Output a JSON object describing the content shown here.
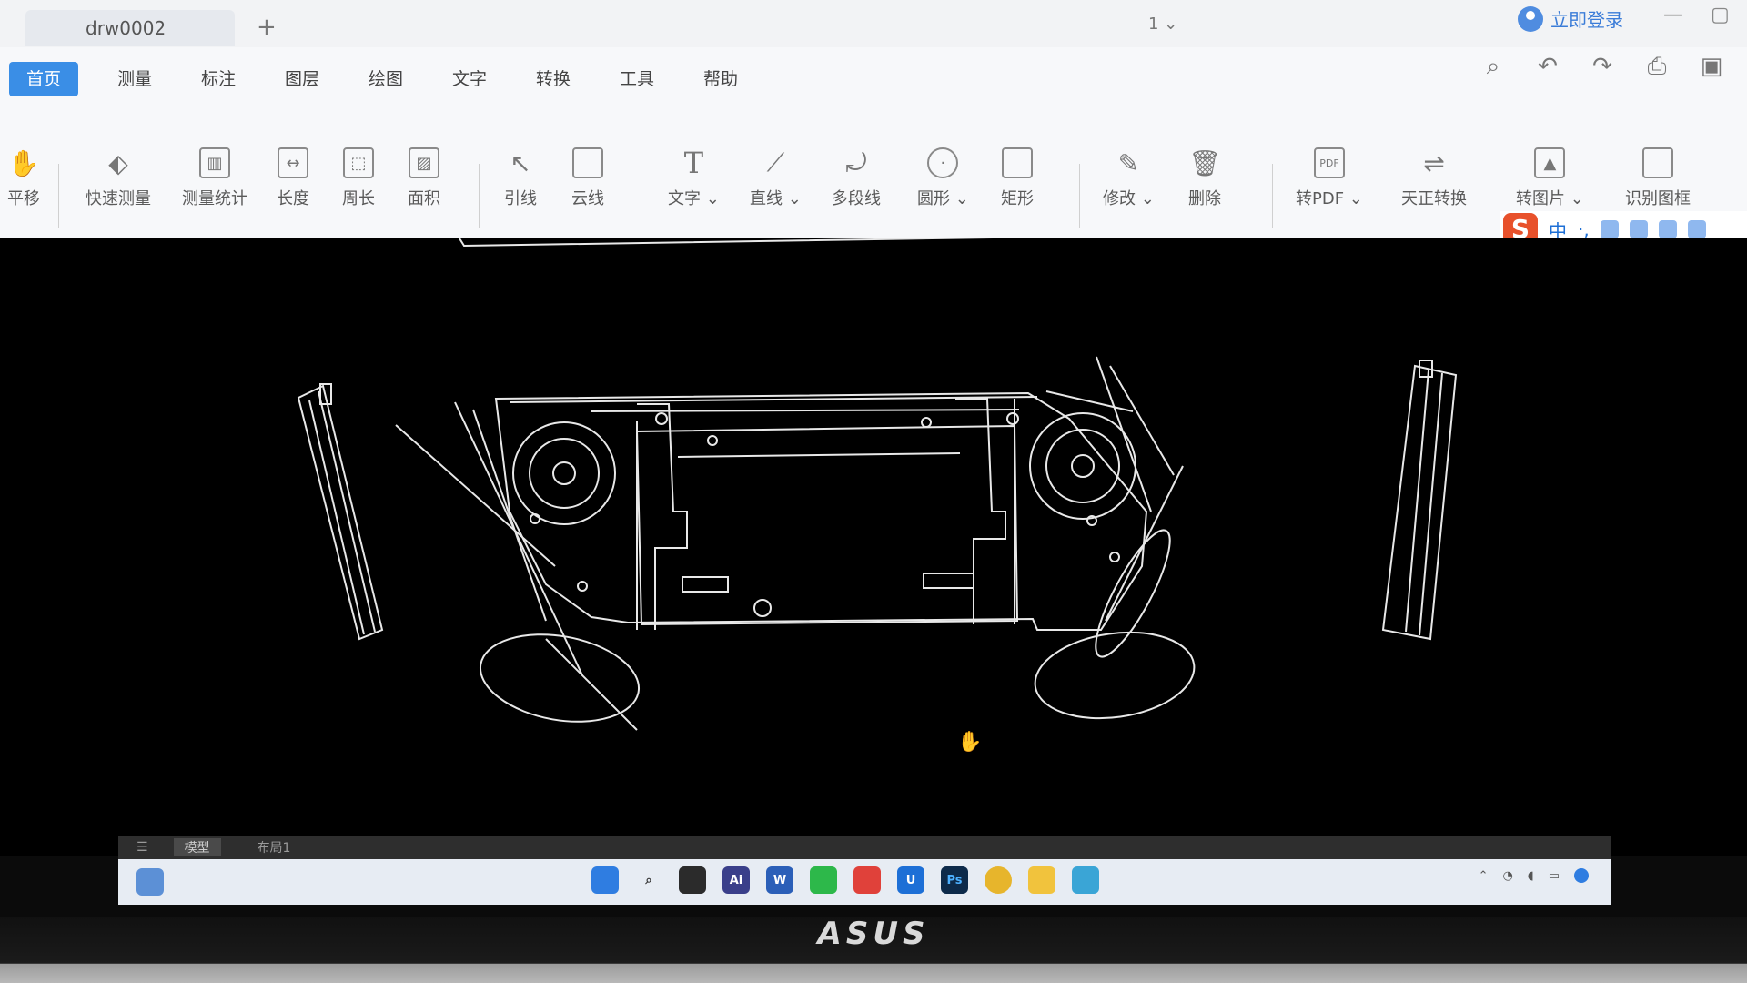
{
  "app": {
    "tab_title": "drw0002",
    "new_tab_symbol": "+",
    "page_selector": "1 ⌄",
    "login_label": "立即登录"
  },
  "menu": {
    "items": [
      "首页",
      "测量",
      "标注",
      "图层",
      "绘图",
      "文字",
      "转换",
      "工具",
      "帮助"
    ],
    "active_index": 0
  },
  "ribbon": {
    "tools": [
      {
        "label": "平移",
        "icon": "hand-icon"
      },
      {
        "label": "快速测量",
        "icon": "ruler-icon"
      },
      {
        "label": "测量统计",
        "icon": "measure-stats-icon"
      },
      {
        "label": "长度",
        "icon": "length-icon"
      },
      {
        "label": "周长",
        "icon": "perimeter-icon"
      },
      {
        "label": "面积",
        "icon": "area-icon"
      },
      {
        "label": "引线",
        "icon": "leader-icon"
      },
      {
        "label": "云线",
        "icon": "cloud-line-icon"
      },
      {
        "label": "文字 ⌄",
        "icon": "text-icon"
      },
      {
        "label": "直线 ⌄",
        "icon": "line-icon"
      },
      {
        "label": "多段线",
        "icon": "polyline-icon"
      },
      {
        "label": "圆形 ⌄",
        "icon": "circle-icon"
      },
      {
        "label": "矩形",
        "icon": "rectangle-icon"
      },
      {
        "label": "修改 ⌄",
        "icon": "edit-icon"
      },
      {
        "label": "删除",
        "icon": "trash-icon"
      },
      {
        "label": "转PDF ⌄",
        "icon": "pdf-icon"
      },
      {
        "label": "天正转换",
        "icon": "tangent-convert-icon"
      },
      {
        "label": "转图片 ⌄",
        "icon": "image-icon"
      },
      {
        "label": "识别图框",
        "icon": "frame-detect-icon"
      }
    ],
    "text_glyph": "T",
    "pdf_glyph": "PDF"
  },
  "ime": {
    "logo": "S",
    "lang": "中",
    "punct": "·,"
  },
  "statusbar": {
    "menu_glyph": "☰",
    "tabs": [
      "模型",
      "布局1"
    ],
    "active_index": 0
  },
  "taskbar": {
    "apps": [
      {
        "name": "start",
        "label": "",
        "color": "#2f7de1"
      },
      {
        "name": "search",
        "label": "",
        "color": "#e7ecf3"
      },
      {
        "name": "task-view",
        "label": "",
        "color": "#2b2b2b"
      },
      {
        "name": "illustrator",
        "label": "Ai",
        "color": "#3a3f8a"
      },
      {
        "name": "word",
        "label": "W",
        "color": "#2b5fb8"
      },
      {
        "name": "wechat",
        "label": "",
        "color": "#2db84a"
      },
      {
        "name": "red-app",
        "label": "",
        "color": "#e0413a"
      },
      {
        "name": "u-app",
        "label": "U",
        "color": "#1d6fd6"
      },
      {
        "name": "photoshop",
        "label": "Ps",
        "color": "#0d2a4a"
      },
      {
        "name": "chrome",
        "label": "",
        "color": "#e7b52c"
      },
      {
        "name": "explorer",
        "label": "",
        "color": "#f1c33d"
      },
      {
        "name": "cad-viewer",
        "label": "",
        "color": "#3aa5d6"
      }
    ]
  },
  "brand": "ASUS",
  "colors": {
    "accent": "#3a8ee6",
    "canvas": "#000000",
    "drawing": "#e8e8e8"
  }
}
